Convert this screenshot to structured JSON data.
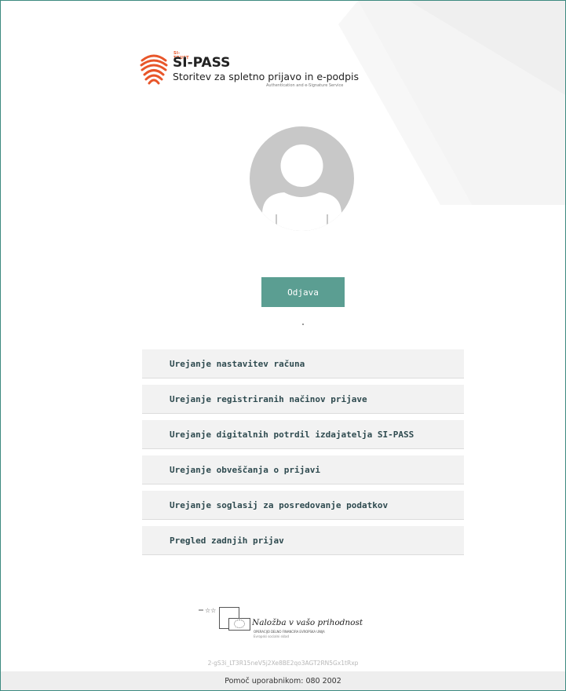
{
  "brand": {
    "small": "SI-TRUST",
    "name": "SI-PASS",
    "subtitle": "Storitev za spletno prijavo in e-podpis",
    "subtitle_en": "Authentication and e-Signature Service",
    "accent_color": "#e8562a"
  },
  "actions": {
    "logout_label": "Odjava"
  },
  "menu": {
    "items": [
      {
        "label": "Urejanje nastavitev računa"
      },
      {
        "label": "Urejanje registriranih načinov prijave"
      },
      {
        "label": "Urejanje digitalnih potrdil izdajatelja SI-PASS"
      },
      {
        "label": "Urejanje obveščanja o prijavi"
      },
      {
        "label": "Urejanje soglasij za posredovanje podatkov"
      },
      {
        "label": "Pregled zadnjih prijav"
      }
    ]
  },
  "eu": {
    "title": "Naložba v vašo prihodnost",
    "line1": "OPERACIJO DELNO FINANCIRA EVROPSKA UNIJA",
    "line2": "Evropski socialni sklad"
  },
  "session_id": "2-gS3i_LT3R15neV5j2Xe8BE2qo3AGT2RN5Gx1tRxp",
  "footer": {
    "help": "Pomoč uporabnikom: 080 2002"
  },
  "colors": {
    "primary": "#5b9e92",
    "menu_text": "#2e4a4f",
    "border": "#3d8a80"
  }
}
